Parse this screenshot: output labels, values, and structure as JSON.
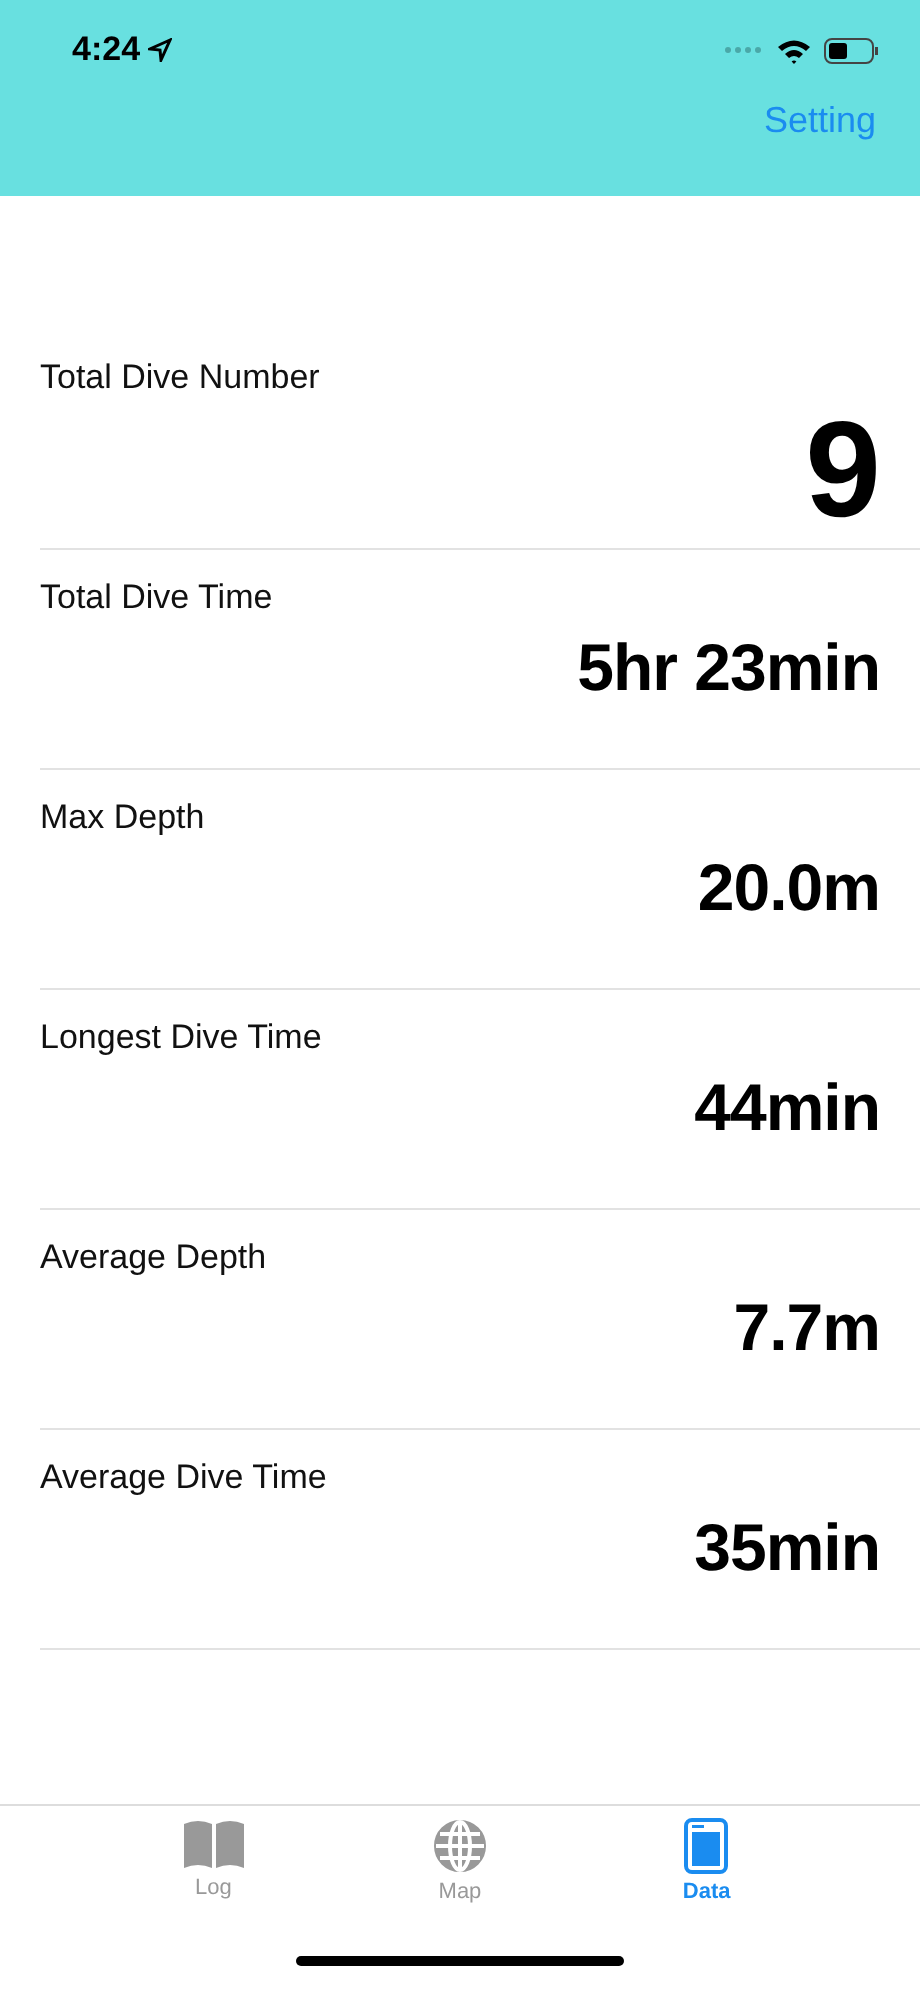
{
  "status_bar": {
    "time": "4:24"
  },
  "nav": {
    "action": "Setting"
  },
  "stats": [
    {
      "label": "Total Dive Number",
      "value": "9",
      "kind": "hero"
    },
    {
      "label": "Total Dive Time",
      "value": "5hr 23min",
      "kind": "normal"
    },
    {
      "label": "Max Depth",
      "value": "20.0m",
      "kind": "normal"
    },
    {
      "label": "Longest Dive Time",
      "value": "44min",
      "kind": "normal"
    },
    {
      "label": "Average Depth",
      "value": "7.7m",
      "kind": "normal"
    },
    {
      "label": "Average Dive Time",
      "value": "35min",
      "kind": "normal"
    }
  ],
  "tabs": [
    {
      "label": "Log",
      "kind": "book",
      "selected": false
    },
    {
      "label": "Map",
      "kind": "globe",
      "selected": false
    },
    {
      "label": "Data",
      "kind": "tablet",
      "selected": true
    }
  ]
}
